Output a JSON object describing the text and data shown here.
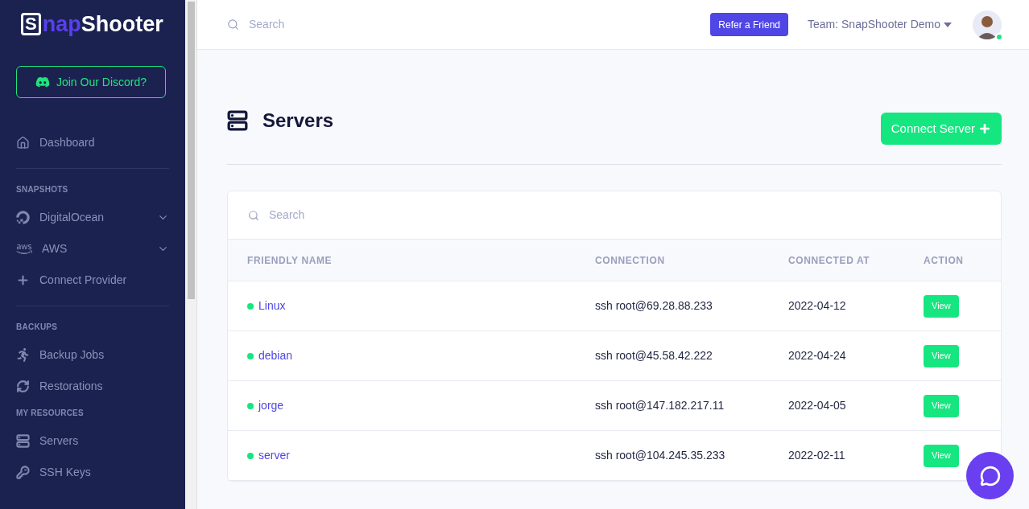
{
  "sidebar": {
    "logo": {
      "part1": "S",
      "part2": "nap",
      "part3": "Shooter"
    },
    "discord_button": "Join Our Discord?",
    "items": [
      {
        "kind": "link",
        "label": "Dashboard"
      },
      {
        "kind": "divider"
      },
      {
        "kind": "heading",
        "label": "SNAPSHOTS"
      },
      {
        "kind": "expandable",
        "label": "DigitalOcean",
        "expanded": false
      },
      {
        "kind": "expandable",
        "label": "AWS",
        "expanded": false
      },
      {
        "kind": "link",
        "label": "Connect Provider"
      },
      {
        "kind": "divider"
      },
      {
        "kind": "heading",
        "label": "BACKUPS"
      },
      {
        "kind": "link",
        "label": "Backup Jobs"
      },
      {
        "kind": "link",
        "label": "Restorations"
      },
      {
        "kind": "heading",
        "label": "MY RESOURCES"
      },
      {
        "kind": "link",
        "label": "Servers"
      },
      {
        "kind": "link",
        "label": "SSH Keys"
      }
    ]
  },
  "header": {
    "search": {
      "placeholder": "Search"
    },
    "refer_button": "Refer a Friend",
    "team": "Team: SnapShooter Demo",
    "avatar": {
      "online": true
    }
  },
  "page": {
    "title": "Servers",
    "connect_button": "Connect Server"
  },
  "table": {
    "search": {
      "placeholder": "Search"
    },
    "columns": [
      "FRIENDLY NAME",
      "CONNECTION",
      "CONNECTED AT",
      "ACTION"
    ],
    "rows": [
      {
        "name": "Linux",
        "online": true,
        "connection": "ssh root@69.28.88.233",
        "connected_at": "2022-04-12",
        "action": "View"
      },
      {
        "name": "debian",
        "online": true,
        "connection": "ssh root@45.58.42.222",
        "connected_at": "2022-04-24",
        "action": "View"
      },
      {
        "name": "jorge",
        "online": true,
        "connection": "ssh root@147.182.217.11",
        "connected_at": "2022-04-05",
        "action": "View"
      },
      {
        "name": "server",
        "online": true,
        "connection": "ssh root@104.245.35.233",
        "connected_at": "2022-02-11",
        "action": "View"
      }
    ]
  }
}
